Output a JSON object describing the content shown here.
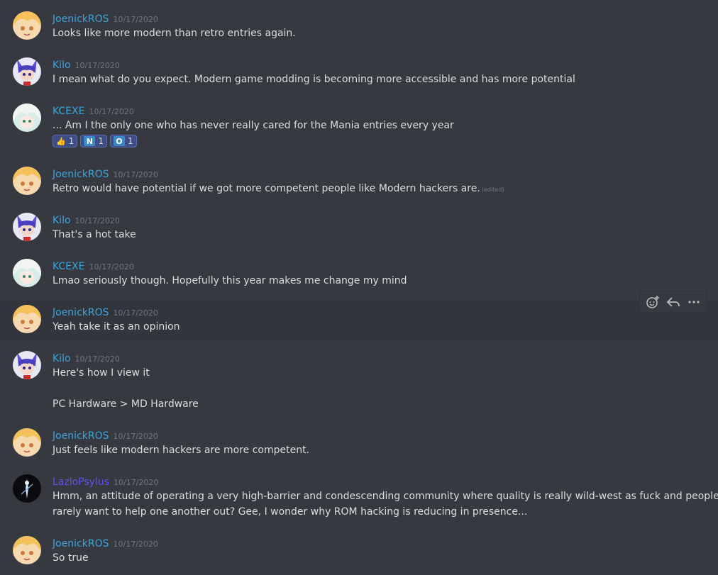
{
  "colors": {
    "background": "#36393f",
    "hover_background": "#32353b",
    "text": "#dcddde",
    "timestamp": "#72767d",
    "username_default": "#3ca4dc",
    "username_lazlo": "#5a55f0",
    "reaction_bg": "#3f4d87"
  },
  "messages": [
    {
      "username": "JoenickROS",
      "avatar_icon": "blonde-anime-avatar-icon",
      "timestamp": "10/17/2020",
      "lines": [
        "Looks like more modern than retro entries again."
      ]
    },
    {
      "username": "Kilo",
      "avatar_icon": "purple-fox-avatar-icon",
      "timestamp": "10/17/2020",
      "lines": [
        "I mean what do you expect. Modern game modding is becoming more accessible and has more potential"
      ]
    },
    {
      "username": "KCEXE",
      "avatar_icon": "white-hair-anime-avatar-icon",
      "timestamp": "10/17/2020",
      "lines": [
        "... Am I the only one who has never really cared for the Mania entries every year"
      ],
      "reactions": [
        {
          "glyph": "👍",
          "icon": "thumbs-up-icon",
          "count": "1"
        },
        {
          "glyph": "N",
          "icon": "letter-n-icon",
          "count": "1"
        },
        {
          "glyph": "O",
          "icon": "letter-o-icon",
          "count": "1"
        }
      ]
    },
    {
      "username": "JoenickROS",
      "avatar_icon": "blonde-anime-avatar-icon",
      "timestamp": "10/17/2020",
      "lines": [
        "Retro would have potential if we got more competent people like Modern hackers are."
      ],
      "edited": "(edited)"
    },
    {
      "username": "Kilo",
      "avatar_icon": "purple-fox-avatar-icon",
      "timestamp": "10/17/2020",
      "lines": [
        "That's a hot take"
      ]
    },
    {
      "username": "KCEXE",
      "avatar_icon": "white-hair-anime-avatar-icon",
      "timestamp": "10/17/2020",
      "lines": [
        "Lmao seriously though. Hopefully this year makes me change my mind"
      ]
    },
    {
      "username": "JoenickROS",
      "avatar_icon": "blonde-anime-avatar-icon",
      "timestamp": "10/17/2020",
      "lines": [
        "Yeah take it as an opinion"
      ]
    },
    {
      "username": "Kilo",
      "avatar_icon": "purple-fox-avatar-icon",
      "timestamp": "10/17/2020",
      "lines": [
        "Here's how I view it",
        "",
        "PC Hardware > MD Hardware"
      ]
    },
    {
      "username": "JoenickROS",
      "avatar_icon": "blonde-anime-avatar-icon",
      "timestamp": "10/17/2020",
      "lines": [
        "Just feels like modern hackers are more competent."
      ]
    },
    {
      "username": "LazloPsylus",
      "avatar_icon": "dark-figure-avatar-icon",
      "timestamp": "10/17/2020",
      "lines": [
        "Hmm, an attitude of operating a very high-barrier and condescending community where quality is really wild-west as fuck and people",
        "rarely want to help one another out? Gee, I wonder why ROM hacking is reducing in presence..."
      ]
    },
    {
      "username": "JoenickROS",
      "avatar_icon": "blonde-anime-avatar-icon",
      "timestamp": "10/17/2020",
      "lines": [
        "So true"
      ]
    }
  ],
  "hover_toolbar": {
    "items": [
      {
        "icon": "add-reaction-icon"
      },
      {
        "icon": "reply-icon"
      },
      {
        "icon": "more-options-icon"
      }
    ]
  }
}
